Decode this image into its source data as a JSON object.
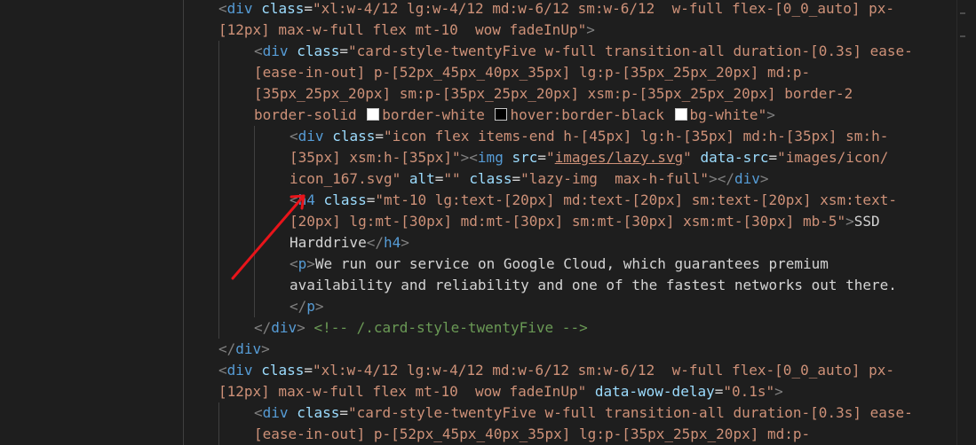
{
  "colors": {
    "background": "#1e1e1e",
    "tag": "#569cd6",
    "attribute": "#9cdcfe",
    "string": "#ce9178",
    "punctuation": "#808080",
    "text": "#d4d4d4",
    "comment": "#6a9955",
    "annotation_arrow": "#e8141a",
    "swatch_white": "#ffffff",
    "swatch_black": "#000000"
  },
  "lines": [
    {
      "tokens": [
        [
          "pun",
          "<"
        ],
        [
          "tag",
          "div"
        ],
        [
          "txt",
          " "
        ],
        [
          "attr",
          "class"
        ],
        [
          "txt",
          "="
        ],
        [
          "str",
          "\"xl:w-4/12 lg:w-4/12 md:w-6/12 sm:w-6/12  w-full flex-[0_0_auto] px-"
        ]
      ]
    },
    {
      "tokens": [
        [
          "str",
          "[12px] max-w-full flex mt-10  wow fadeInUp\""
        ],
        [
          "pun",
          ">"
        ]
      ]
    },
    {
      "tokens": [
        [
          "pun",
          "<"
        ],
        [
          "tag",
          "div"
        ],
        [
          "txt",
          " "
        ],
        [
          "attr",
          "class"
        ],
        [
          "txt",
          "="
        ],
        [
          "str",
          "\"card-style-twentyFive w-full transition-all duration-[0.3s] ease-"
        ]
      ]
    },
    {
      "tokens": [
        [
          "str",
          "[ease-in-out] p-[52px_45px_40px_35px] lg:p-[35px_25px_20px] md:p-"
        ]
      ]
    },
    {
      "tokens": [
        [
          "str",
          "[35px_25px_20px] sm:p-[35px_25px_20px] xsm:p-[35px_25px_20px] border-2"
        ]
      ]
    },
    {
      "tokens": [
        [
          "str",
          "border-solid "
        ],
        [
          "swatch",
          "#ffffff"
        ],
        [
          "str",
          "border-white "
        ],
        [
          "swatch",
          "#000000"
        ],
        [
          "str",
          "hover:border-black "
        ],
        [
          "swatch",
          "#ffffff"
        ],
        [
          "str",
          "bg-white\""
        ],
        [
          "pun",
          ">"
        ]
      ]
    },
    {
      "tokens": [
        [
          "pun",
          "<"
        ],
        [
          "tag",
          "div"
        ],
        [
          "txt",
          " "
        ],
        [
          "attr",
          "class"
        ],
        [
          "txt",
          "="
        ],
        [
          "str",
          "\"icon flex items-end h-[45px] lg:h-[35px] md:h-[35px] sm:h-"
        ]
      ]
    },
    {
      "tokens": [
        [
          "str",
          "[35px] xsm:h-[35px]\""
        ],
        [
          "pun",
          "><"
        ],
        [
          "tag",
          "img"
        ],
        [
          "txt",
          " "
        ],
        [
          "attr",
          "src"
        ],
        [
          "txt",
          "="
        ],
        [
          "str",
          "\""
        ],
        [
          "link",
          "images/lazy.svg"
        ],
        [
          "str",
          "\""
        ],
        [
          "txt",
          " "
        ],
        [
          "attr",
          "data-src"
        ],
        [
          "txt",
          "="
        ],
        [
          "str",
          "\"images/icon/"
        ]
      ]
    },
    {
      "tokens": [
        [
          "str",
          "icon_167.svg\""
        ],
        [
          "txt",
          " "
        ],
        [
          "attr",
          "alt"
        ],
        [
          "txt",
          "="
        ],
        [
          "str",
          "\"\""
        ],
        [
          "txt",
          " "
        ],
        [
          "attr",
          "class"
        ],
        [
          "txt",
          "="
        ],
        [
          "str",
          "\"lazy-img  max-h-full\""
        ],
        [
          "pun",
          "></"
        ],
        [
          "tag",
          "div"
        ],
        [
          "pun",
          ">"
        ]
      ]
    },
    {
      "tokens": [
        [
          "pun",
          "<"
        ],
        [
          "tag",
          "h4"
        ],
        [
          "txt",
          " "
        ],
        [
          "attr",
          "class"
        ],
        [
          "txt",
          "="
        ],
        [
          "str",
          "\"mt-10 lg:text-[20px] md:text-[20px] sm:text-[20px] xsm:text-"
        ]
      ]
    },
    {
      "tokens": [
        [
          "str",
          "[20px] lg:mt-[30px] md:mt-[30px] sm:mt-[30px] xsm:mt-[30px] mb-5\""
        ],
        [
          "pun",
          ">"
        ],
        [
          "txt",
          "SSD"
        ]
      ]
    },
    {
      "tokens": [
        [
          "txt",
          "Harddrive"
        ],
        [
          "pun",
          "</"
        ],
        [
          "tag",
          "h4"
        ],
        [
          "pun",
          ">"
        ]
      ]
    },
    {
      "tokens": [
        [
          "pun",
          "<"
        ],
        [
          "tag",
          "p"
        ],
        [
          "pun",
          ">"
        ],
        [
          "txt",
          "We run our service on Google Cloud, which guarantees premium"
        ]
      ]
    },
    {
      "tokens": [
        [
          "txt",
          "availability and reliability and one of the fastest networks out there."
        ]
      ]
    },
    {
      "tokens": [
        [
          "pun",
          "</"
        ],
        [
          "tag",
          "p"
        ],
        [
          "pun",
          ">"
        ]
      ]
    },
    {
      "tokens": [
        [
          "pun",
          "</"
        ],
        [
          "tag",
          "div"
        ],
        [
          "pun",
          ">"
        ],
        [
          "txt",
          " "
        ],
        [
          "cmt",
          "<!-- /.card-style-twentyFive -->"
        ]
      ]
    },
    {
      "tokens": [
        [
          "pun",
          "</"
        ],
        [
          "tag",
          "div"
        ],
        [
          "pun",
          ">"
        ]
      ]
    },
    {
      "tokens": [
        [
          "pun",
          "<"
        ],
        [
          "tag",
          "div"
        ],
        [
          "txt",
          " "
        ],
        [
          "attr",
          "class"
        ],
        [
          "txt",
          "="
        ],
        [
          "str",
          "\"xl:w-4/12 lg:w-4/12 md:w-6/12 sm:w-6/12  w-full flex-[0_0_auto] px-"
        ]
      ]
    },
    {
      "tokens": [
        [
          "str",
          "[12px] max-w-full flex mt-10  wow fadeInUp\""
        ],
        [
          "txt",
          " "
        ],
        [
          "attr",
          "data-wow-delay"
        ],
        [
          "txt",
          "="
        ],
        [
          "str",
          "\"0.1s\""
        ],
        [
          "pun",
          ">"
        ]
      ]
    },
    {
      "tokens": [
        [
          "pun",
          "<"
        ],
        [
          "tag",
          "div"
        ],
        [
          "txt",
          " "
        ],
        [
          "attr",
          "class"
        ],
        [
          "txt",
          "="
        ],
        [
          "str",
          "\"card-style-twentyFive w-full transition-all duration-[0.3s] ease-"
        ]
      ]
    },
    {
      "tokens": [
        [
          "str",
          "[ease-in-out] p-[52px_45px_40px_35px] lg:p-[35px_25px_20px] md:p-"
        ]
      ]
    }
  ]
}
